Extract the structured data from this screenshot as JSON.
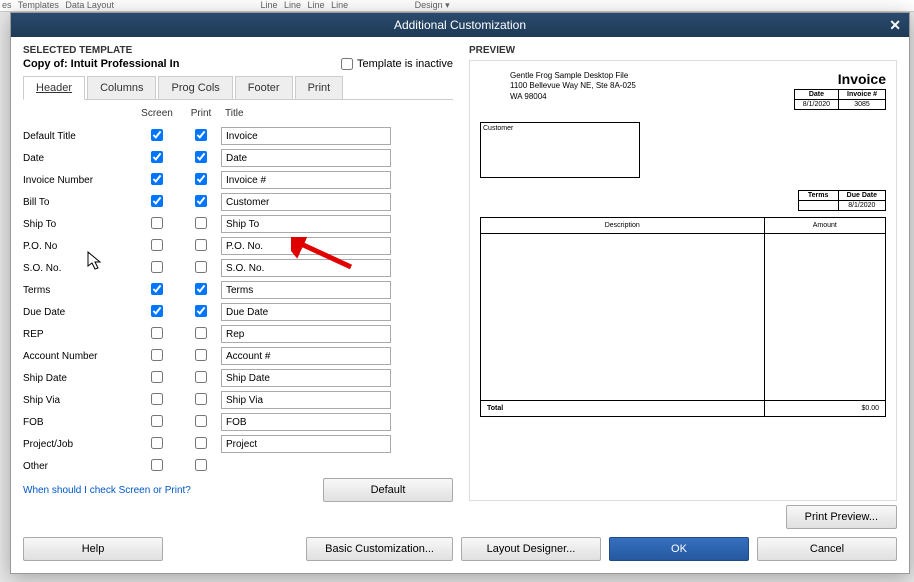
{
  "topbar": [
    "es",
    "Templates",
    "Data Layout",
    "Line",
    "Line",
    "Line",
    "Line",
    "Design ▾"
  ],
  "modal_title": "Additional Customization",
  "selected_template_label": "SELECTED TEMPLATE",
  "template_name": "Copy of: Intuit Professional In",
  "inactive_label": "Template is inactive",
  "tabs": [
    "Header",
    "Columns",
    "Prog Cols",
    "Footer",
    "Print"
  ],
  "active_tab": 0,
  "col_headers": {
    "screen": "Screen",
    "print": "Print",
    "title": "Title"
  },
  "fields": [
    {
      "label": "Default Title",
      "screen": true,
      "print": true,
      "title": "Invoice"
    },
    {
      "label": "Date",
      "screen": true,
      "print": true,
      "title": "Date"
    },
    {
      "label": "Invoice Number",
      "screen": true,
      "print": true,
      "title": "Invoice #"
    },
    {
      "label": "Bill To",
      "screen": true,
      "print": true,
      "title": "Customer"
    },
    {
      "label": "Ship To",
      "screen": false,
      "print": false,
      "title": "Ship To"
    },
    {
      "label": "P.O. No",
      "screen": false,
      "print": false,
      "title": "P.O. No."
    },
    {
      "label": "S.O. No.",
      "screen": false,
      "print": false,
      "title": "S.O. No."
    },
    {
      "label": "Terms",
      "screen": true,
      "print": true,
      "title": "Terms"
    },
    {
      "label": "Due Date",
      "screen": true,
      "print": true,
      "title": "Due Date"
    },
    {
      "label": "REP",
      "screen": false,
      "print": false,
      "title": "Rep"
    },
    {
      "label": "Account Number",
      "screen": false,
      "print": false,
      "title": "Account #"
    },
    {
      "label": "Ship Date",
      "screen": false,
      "print": false,
      "title": "Ship Date"
    },
    {
      "label": "Ship Via",
      "screen": false,
      "print": false,
      "title": "Ship Via"
    },
    {
      "label": "FOB",
      "screen": false,
      "print": false,
      "title": "FOB"
    },
    {
      "label": "Project/Job",
      "screen": false,
      "print": false,
      "title": "Project"
    },
    {
      "label": "Other",
      "screen": false,
      "print": false,
      "title": ""
    }
  ],
  "link_text": "When should I check Screen or Print?",
  "default_btn": "Default",
  "buttons": {
    "help": "Help",
    "basic": "Basic Customization...",
    "layout": "Layout Designer...",
    "ok": "OK",
    "cancel": "Cancel",
    "print_preview": "Print Preview..."
  },
  "preview_label": "PREVIEW",
  "invoice": {
    "company": "Gentle Frog Sample Desktop File",
    "addr1": "1100 Bellevue Way NE, Ste 8A-025",
    "addr2": "WA 98004",
    "title": "Invoice",
    "date_hdr": "Date",
    "inv_hdr": "Invoice #",
    "date_val": "8/1/2020",
    "inv_val": "3085",
    "customer_hdr": "Customer",
    "terms_hdr": "Terms",
    "due_hdr": "Due Date",
    "due_val": "8/1/2020",
    "desc_hdr": "Description",
    "amt_hdr": "Amount",
    "total_lbl": "Total",
    "total_val": "$0.00"
  }
}
